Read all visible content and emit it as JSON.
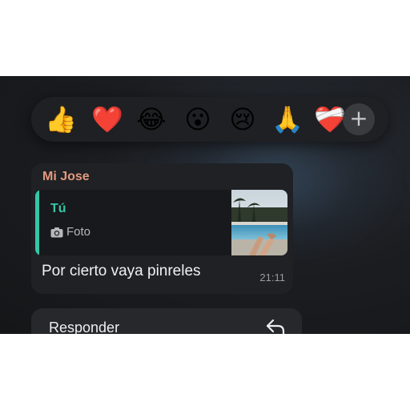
{
  "reactions": {
    "emojis": [
      {
        "name": "thumbs-up",
        "glyph": "👍"
      },
      {
        "name": "red-heart",
        "glyph": "❤️"
      },
      {
        "name": "tears-of-joy",
        "glyph": "😂"
      },
      {
        "name": "astonished",
        "glyph": "😮"
      },
      {
        "name": "crying",
        "glyph": "😢"
      },
      {
        "name": "folded-hands",
        "glyph": "🙏"
      },
      {
        "name": "mending-heart",
        "glyph": "❤️‍🩹"
      }
    ],
    "add_label": "+"
  },
  "message": {
    "sender": "Mi Jose",
    "sender_color": "#e39a7e",
    "quote": {
      "author": "Tú",
      "author_color": "#35c8a8",
      "media_label": "Foto",
      "media_icon": "camera-icon"
    },
    "text": "Por cierto vaya pinreles",
    "time": "21:11"
  },
  "menu": {
    "reply_label": "Responder",
    "reply_icon": "reply-arrow-icon"
  }
}
